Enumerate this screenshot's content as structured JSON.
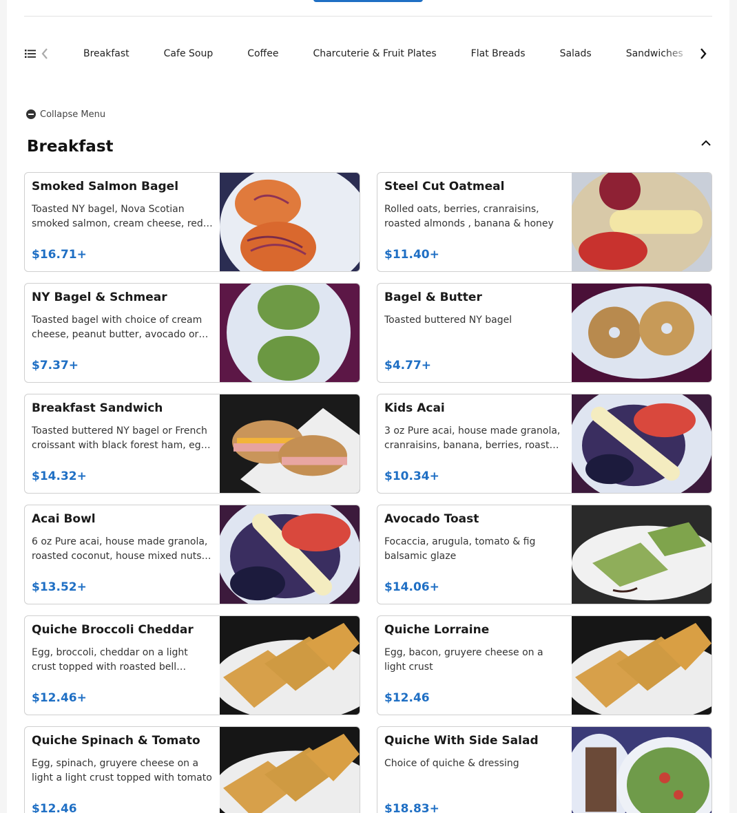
{
  "categories": [
    "Breakfast",
    "Cafe Soup",
    "Coffee",
    "Charcuterie & Fruit Plates",
    "Flat Breads",
    "Salads",
    "Sandwiches"
  ],
  "collapse_label": "Collapse Menu",
  "section_title": "Breakfast",
  "colors": {
    "accent": "#1f6fc4",
    "text": "#1a1a1a",
    "border": "#cfcfcf"
  },
  "items": [
    {
      "name": "Smoked Salmon Bagel",
      "desc": "Toasted NY bagel, Nova Scotian smoked salmon, cream cheese, red onion, capers",
      "price": "$16.71+"
    },
    {
      "name": "Steel Cut Oatmeal",
      "desc": "Rolled oats, berries, cranraisins, roasted almonds , banana & honey",
      "price": "$11.40+"
    },
    {
      "name": "NY Bagel & Schmear",
      "desc": "Toasted bagel with choice of cream cheese, peanut butter, avocado or butter",
      "price": "$7.37+"
    },
    {
      "name": "Bagel & Butter",
      "desc": "Toasted buttered NY bagel",
      "price": "$4.77+"
    },
    {
      "name": "Breakfast Sandwich",
      "desc": "Toasted buttered NY bagel or French croissant with black forest ham, egg & cheese",
      "price": "$14.32+"
    },
    {
      "name": "Kids Acai",
      "desc": "3 oz Pure acai, house made granola, cranraisins, banana, berries, roasted coconut",
      "price": "$10.34+"
    },
    {
      "name": "Acai Bowl",
      "desc": "6 oz Pure acai, house made granola, roasted coconut, house mixed nuts, banana, berries",
      "price": "$13.52+"
    },
    {
      "name": "Avocado Toast",
      "desc": "Focaccia, arugula, tomato & fig balsamic glaze",
      "price": "$14.06+"
    },
    {
      "name": "Quiche Broccoli Cheddar",
      "desc": "Egg, broccoli, cheddar on a light crust topped with roasted bell peppers",
      "price": "$12.46+"
    },
    {
      "name": "Quiche Lorraine",
      "desc": "Egg, bacon, gruyere cheese on a light crust",
      "price": "$12.46"
    },
    {
      "name": "Quiche Spinach & Tomato",
      "desc": "Egg, spinach, gruyere cheese on a light a light crust topped with tomato",
      "price": "$12.46"
    },
    {
      "name": "Quiche With Side Salad",
      "desc": "Choice of quiche & dressing",
      "price": "$18.83+"
    }
  ]
}
